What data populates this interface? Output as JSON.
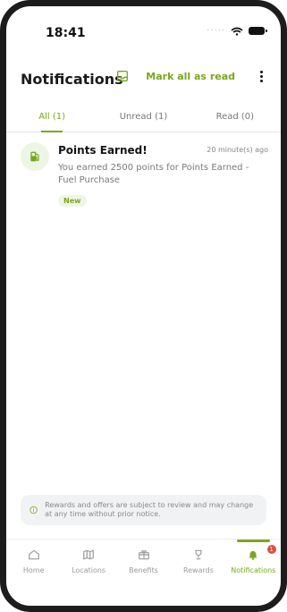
{
  "status_bar": {
    "time": "18:41",
    "signal": "·····"
  },
  "header": {
    "title": "Notifications",
    "mark_all_label": "Mark all as read"
  },
  "tabs": [
    {
      "label": "All (1)",
      "active": true
    },
    {
      "label": "Unread (1)",
      "active": false
    },
    {
      "label": "Read (0)",
      "active": false
    }
  ],
  "notifications": [
    {
      "title": "Points Earned!",
      "time": "20 minute(s) ago",
      "body": "You earned 2500 points for Points Earned - Fuel Purchase",
      "badge": "New",
      "icon": "fuel-icon"
    }
  ],
  "disclaimer": {
    "text": "Rewards and offers are subject to review and may change at any time without prior notice."
  },
  "bottom_nav": [
    {
      "label": "Home",
      "icon": "home-icon"
    },
    {
      "label": "Locations",
      "icon": "map-icon"
    },
    {
      "label": "Benefits",
      "icon": "gift-icon"
    },
    {
      "label": "Rewards",
      "icon": "trophy-icon"
    },
    {
      "label": "Notifications",
      "icon": "bell-icon",
      "badge": "1",
      "active": true
    }
  ],
  "colors": {
    "accent": "#7aa81a",
    "badge_red": "#e34b40"
  }
}
